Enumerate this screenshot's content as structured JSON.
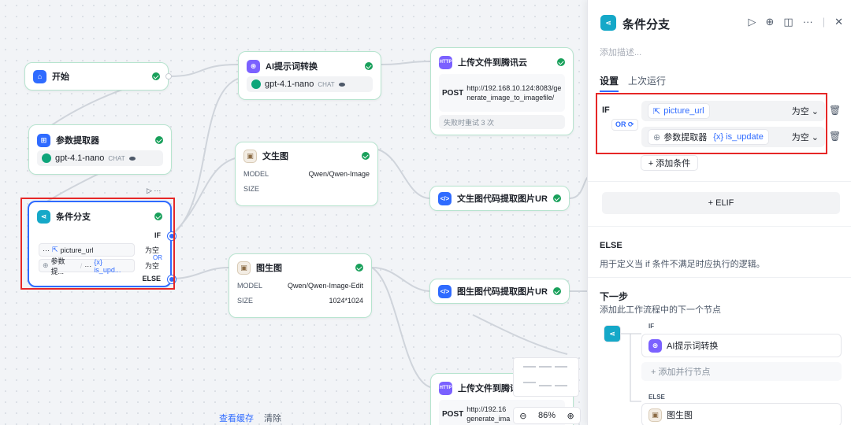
{
  "nodes": {
    "start": {
      "title": "开始"
    },
    "param": {
      "title": "参数提取器",
      "model": "gpt-4.1-nano",
      "model_tag": "CHAT"
    },
    "cond": {
      "title": "条件分支",
      "if_label": "IF",
      "else_label": "ELSE",
      "or_label": "OR",
      "row1_var": "picture_url",
      "row1_op": "为空",
      "row2_src": "参数提...",
      "row2_var": "{x} is_upd...",
      "row2_op": "为空",
      "ellipsis": "···",
      "slash": "/"
    },
    "ai": {
      "title": "AI提示词转换",
      "model": "gpt-4.1-nano",
      "model_tag": "CHAT"
    },
    "wst": {
      "title": "文生图",
      "model_label": "MODEL",
      "model_value": "Qwen/Qwen-Image",
      "size_label": "SIZE"
    },
    "tst": {
      "title": "图生图",
      "model_label": "MODEL",
      "model_value": "Qwen/Qwen-Image-Edit",
      "size_label": "SIZE",
      "size_value": "1024*1024"
    },
    "upload1": {
      "title": "上传文件到腾讯云",
      "method": "POST",
      "url": "http://192.168.10.124:8083/generate_image_to_imagefile/",
      "retry": "失败时重试 3 次"
    },
    "code1": {
      "title": "文生图代码提取图片URL"
    },
    "code2": {
      "title": "图生图代码提取图片URL"
    },
    "upload2": {
      "title": "上传文件到腾讯",
      "method": "POST",
      "url": "http://192.16 generate_ima"
    }
  },
  "canvas_footer": {
    "view_cache": "查看缓存",
    "clear": "清除",
    "zoom": "86%"
  },
  "panel": {
    "title": "条件分支",
    "desc_placeholder": "添加描述...",
    "tabs": [
      "设置",
      "上次运行"
    ],
    "if_label": "IF",
    "or_label": "OR",
    "cond1_var": "picture_url",
    "cond1_op": "为空",
    "cond2_src": "参数提取器",
    "cond2_var": "{x} is_update",
    "cond2_op": "为空",
    "add_condition": "+ 添加条件",
    "elif": "+ ELIF",
    "else_title": "ELSE",
    "else_desc": "用于定义当 if 条件不满足时应执行的逻辑。",
    "next_title": "下一步",
    "next_desc": "添加此工作流程中的下一个节点",
    "next_if": "IF",
    "next_if_node": "AI提示词转换",
    "add_parallel": "+ 添加并行节点",
    "next_else": "ELSE",
    "next_else_node": "图生图"
  },
  "icons": [
    "home-icon",
    "param-icon",
    "branch-icon",
    "ai-icon",
    "http-icon",
    "code-icon",
    "image-icon",
    "play-icon",
    "debug-icon",
    "layout-icon",
    "more-icon",
    "close-icon",
    "delete-icon",
    "zoom-in-icon",
    "zoom-out-icon"
  ],
  "colors": {
    "accent": "#2f6bff",
    "success": "#19a05b",
    "highlight": "#e62727"
  }
}
